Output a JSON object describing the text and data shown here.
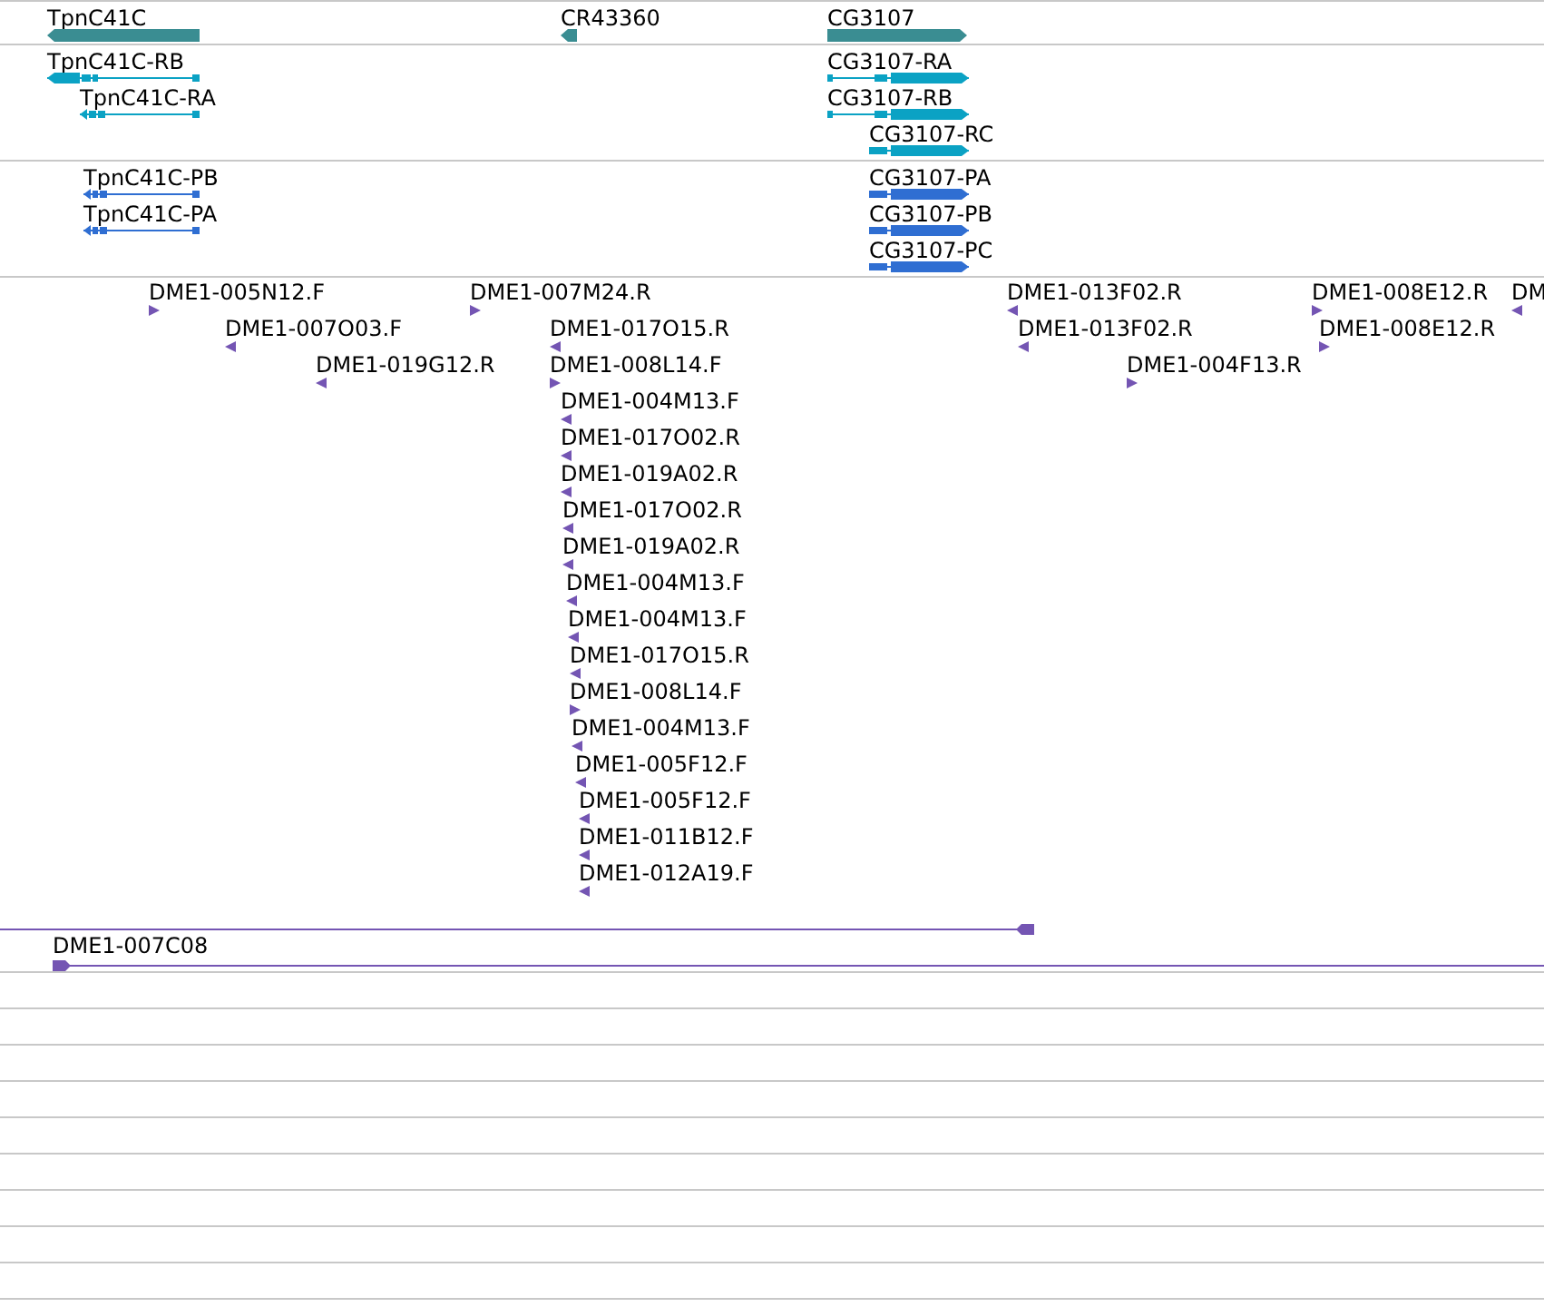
{
  "tracks": [
    {
      "kind": "gene",
      "features": [
        {
          "label": "TpnC41C",
          "forward": false
        },
        {
          "label": "CR43360",
          "forward": false
        },
        {
          "label": "CG3107",
          "forward": true
        }
      ]
    },
    {
      "kind": "transcript",
      "features": [
        {
          "label": "TpnC41C-RB",
          "forward": false
        },
        {
          "label": "TpnC41C-RA",
          "forward": false
        },
        {
          "label": "CG3107-RA",
          "forward": true
        },
        {
          "label": "CG3107-RB",
          "forward": true
        },
        {
          "label": "CG3107-RC",
          "forward": true
        }
      ]
    },
    {
      "kind": "protein",
      "features": [
        {
          "label": "TpnC41C-PB",
          "forward": false
        },
        {
          "label": "TpnC41C-PA",
          "forward": false
        },
        {
          "label": "CG3107-PA",
          "forward": true
        },
        {
          "label": "CG3107-PB",
          "forward": true
        },
        {
          "label": "CG3107-PC",
          "forward": true
        }
      ]
    },
    {
      "kind": "est",
      "features": [
        {
          "kind": "est",
          "label": "DME1-005N12.F",
          "forward": true
        },
        {
          "kind": "est",
          "label": "DME1-007M24.R",
          "forward": true
        },
        {
          "kind": "est",
          "label": "DME1-007O03.F",
          "forward": false
        },
        {
          "kind": "est",
          "label": "DME1-017O15.R",
          "forward": false
        },
        {
          "kind": "est",
          "label": "DME1-019G12.R",
          "forward": false
        },
        {
          "kind": "est",
          "label": "DME1-008L14.F",
          "forward": true
        },
        {
          "kind": "est",
          "label": "DME1-004M13.F",
          "forward": false
        },
        {
          "kind": "est",
          "label": "DME1-017O02.R",
          "forward": false
        },
        {
          "kind": "est",
          "label": "DME1-019A02.R",
          "forward": false
        },
        {
          "kind": "est",
          "label": "DME1-017O02.R",
          "forward": false
        },
        {
          "kind": "est",
          "label": "DME1-019A02.R",
          "forward": false
        },
        {
          "kind": "est",
          "label": "DME1-004M13.F",
          "forward": false
        },
        {
          "kind": "est",
          "label": "DME1-004M13.F",
          "forward": false
        },
        {
          "kind": "est",
          "label": "DME1-017O15.R",
          "forward": false
        },
        {
          "kind": "est",
          "label": "DME1-008L14.F",
          "forward": true
        },
        {
          "kind": "est",
          "label": "DME1-004M13.F",
          "forward": false
        },
        {
          "kind": "est",
          "label": "DME1-005F12.F",
          "forward": false
        },
        {
          "kind": "est",
          "label": "DME1-005F12.F",
          "forward": false
        },
        {
          "kind": "est",
          "label": "DME1-011B12.F",
          "forward": false
        },
        {
          "kind": "est",
          "label": "DME1-012A19.F",
          "forward": false
        },
        {
          "kind": "est",
          "label": "DME1-013F02.R",
          "forward": false
        },
        {
          "kind": "est",
          "label": "DME1-008E12.R",
          "forward": true
        },
        {
          "kind": "est",
          "label": "DME1-013F02.R",
          "forward": false
        },
        {
          "kind": "est",
          "label": "DME1-008E12.R",
          "forward": true
        },
        {
          "kind": "est",
          "label": "DME1-004F13.R",
          "forward": true
        },
        {
          "kind": "est",
          "label": "DM",
          "forward": false
        },
        {
          "kind": "long_read",
          "forward": false
        },
        {
          "kind": "long_read",
          "label": "DME1-007C08",
          "forward": true
        }
      ]
    }
  ]
}
